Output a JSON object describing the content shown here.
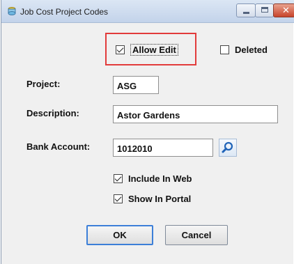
{
  "window": {
    "title": "Job Cost Project Codes",
    "app_icon": "app-icon",
    "controls": [
      "minimize-icon",
      "maximize-icon",
      "close-icon"
    ],
    "close_color": "#c8442b"
  },
  "form": {
    "allow_edit": {
      "label": "Allow Edit",
      "checked": true
    },
    "deleted": {
      "label": "Deleted",
      "checked": false
    },
    "project": {
      "label": "Project:",
      "value": "ASG"
    },
    "description": {
      "label": "Description:",
      "value": "Astor Gardens"
    },
    "bank_account": {
      "label": "Bank Account:",
      "value": "1012010",
      "lookup_icon": "search-icon"
    },
    "include_in_web": {
      "label": "Include In Web",
      "checked": true
    },
    "show_in_portal": {
      "label": "Show In Portal",
      "checked": true
    }
  },
  "buttons": {
    "ok": "OK",
    "cancel": "Cancel"
  },
  "colors": {
    "highlight": "#e23b3b",
    "default_button_border": "#3c7fd8"
  }
}
